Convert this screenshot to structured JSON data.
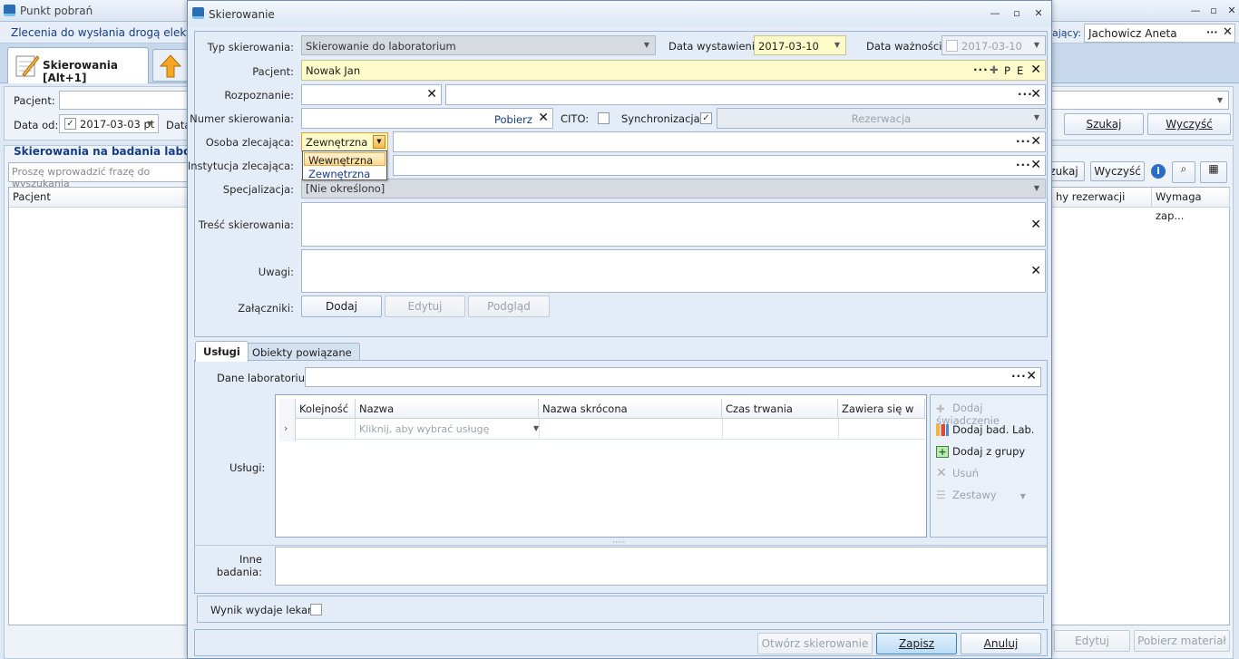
{
  "background": {
    "title": "Punkt pobrań",
    "toolbar_label": "Zlecenia do wysłania drogą elektroni",
    "right_label": "ający:",
    "right_user": "Jachowicz Aneta",
    "active_tab": "Skierowania [Alt+1]",
    "filter": {
      "pacjent_label": "Pacjent:",
      "data_od_label": "Data od:",
      "data_od_value": "2017-03-03 pt",
      "data_label_partial": "Data",
      "szukaj": "Szukaj",
      "wyczysc": "Wyczyść"
    },
    "list": {
      "title": "Skierowania na badania laboratoryjn",
      "search_placeholder": "Proszę wprowadzić frazę do wyszukania",
      "szukaj_partial": "zukaj",
      "wyczysc": "Wyczyść",
      "columns": [
        "Pacjent",
        "hy rezerwacji",
        "Wymaga zap..."
      ],
      "edytuj": "Edytuj",
      "pobierz_material": "Pobierz materiał"
    }
  },
  "dialog": {
    "title": "Skierowanie",
    "typ_label": "Typ skierowania:",
    "typ_value": "Skierowanie do laboratorium",
    "data_wyst_label": "Data wystawienia:",
    "data_wyst_value": "2017-03-10",
    "data_waz_label": "Data ważności:",
    "data_waz_value": "2017-03-10",
    "pacjent_label": "Pacjent:",
    "pacjent_value": "Nowak Jan",
    "pacjent_p": "P",
    "pacjent_e": "E",
    "rozpoznanie_label": "Rozpoznanie:",
    "numer_label": "Numer skierowania:",
    "pobierz": "Pobierz",
    "cito_label": "CITO:",
    "sync_label": "Synchronizacja:",
    "rezerwacja": "Rezerwacja",
    "osoba_label": "Osoba zlecająca:",
    "osoba_value": "Zewnętrzna",
    "osoba_options": [
      "Wewnętrzna",
      "Zewnętrzna"
    ],
    "instytucja_label": "Instytucja zlecająca:",
    "specjalizacja_label": "Specjalizacja:",
    "specjalizacja_value": "[Nie określono]",
    "tresc_label": "Treść skierowania:",
    "uwagi_label": "Uwagi:",
    "zalaczniki_label": "Załączniki:",
    "dodaj": "Dodaj",
    "edytuj": "Edytuj",
    "podglad": "Podgląd",
    "tabs": [
      "Usługi",
      "Obiekty powiązane"
    ],
    "dane_lab_label": "Dane laboratorium:",
    "uslugi_label": "Usługi:",
    "grid_columns": [
      "Kolejność",
      "Nazwa",
      "Nazwa skrócona",
      "Czas trwania",
      "Zawiera się w"
    ],
    "grid_new_row_hint": "Kliknij, aby wybrać usługę",
    "actions": [
      "Dodaj świadczenie",
      "Dodaj bad. Lab.",
      "Dodaj z grupy",
      "Usuń",
      "Zestawy"
    ],
    "inne_label": "Inne badania:",
    "wynik_label": "Wynik wydaje lekarz:",
    "otworz": "Otwórz skierowanie",
    "zapisz": "Zapisz",
    "anuluj": "Anuluj"
  }
}
